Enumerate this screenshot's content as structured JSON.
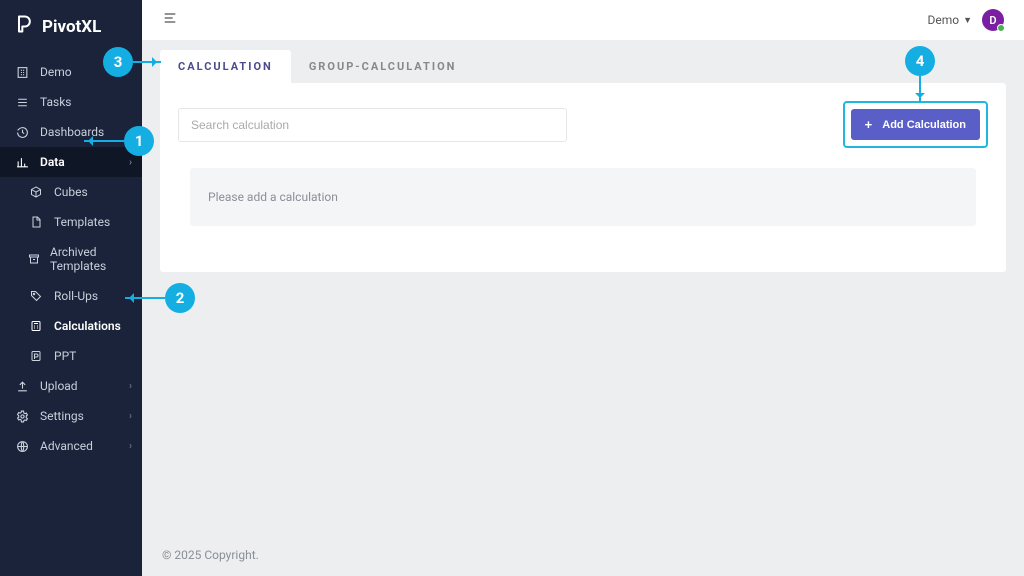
{
  "brand": {
    "name": "PivotXL"
  },
  "topbar": {
    "user_label": "Demo",
    "avatar_initial": "D"
  },
  "sidebar": {
    "items": [
      {
        "icon": "building-icon",
        "label": "Demo",
        "kind": "item"
      },
      {
        "icon": "list-icon",
        "label": "Tasks",
        "kind": "item"
      },
      {
        "icon": "history-icon",
        "label": "Dashboards",
        "kind": "expandable"
      },
      {
        "icon": "chart-icon",
        "label": "Data",
        "kind": "expandable",
        "active": true
      },
      {
        "icon": "cube-icon",
        "label": "Cubes",
        "kind": "sub"
      },
      {
        "icon": "file-icon",
        "label": "Templates",
        "kind": "sub"
      },
      {
        "icon": "archive-icon",
        "label": "Archived Templates",
        "kind": "sub"
      },
      {
        "icon": "tag-icon",
        "label": "Roll-Ups",
        "kind": "sub"
      },
      {
        "icon": "calc-icon",
        "label": "Calculations",
        "kind": "sub",
        "active_sub": true
      },
      {
        "icon": "ppt-icon",
        "label": "PPT",
        "kind": "sub"
      },
      {
        "icon": "upload-icon",
        "label": "Upload",
        "kind": "expandable"
      },
      {
        "icon": "gear-icon",
        "label": "Settings",
        "kind": "expandable"
      },
      {
        "icon": "globe-icon",
        "label": "Advanced",
        "kind": "expandable"
      }
    ]
  },
  "tabs": {
    "calculation": "CALCULATION",
    "group_calculation": "GROUP-CALCULATION"
  },
  "search": {
    "placeholder": "Search calculation"
  },
  "add_button": {
    "label": "Add Calculation"
  },
  "empty_state": {
    "text": "Please add a calculation"
  },
  "footer": {
    "text": "© 2025 Copyright."
  },
  "callouts": {
    "c1": "1",
    "c2": "2",
    "c3": "3",
    "c4": "4"
  }
}
